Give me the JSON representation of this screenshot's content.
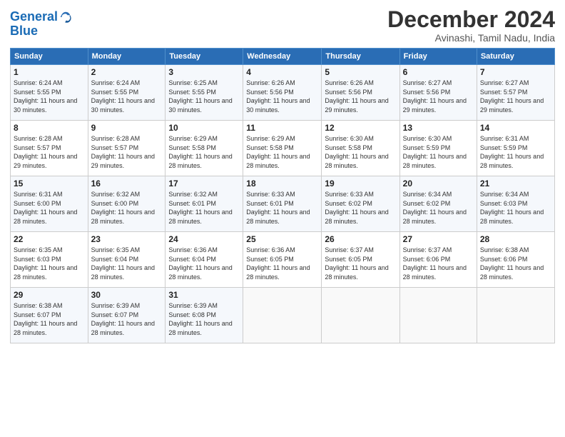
{
  "logo": {
    "line1": "General",
    "line2": "Blue"
  },
  "title": "December 2024",
  "location": "Avinashi, Tamil Nadu, India",
  "headers": [
    "Sunday",
    "Monday",
    "Tuesday",
    "Wednesday",
    "Thursday",
    "Friday",
    "Saturday"
  ],
  "weeks": [
    [
      {
        "day": "1",
        "sunrise": "6:24 AM",
        "sunset": "5:55 PM",
        "daylight": "11 hours and 30 minutes."
      },
      {
        "day": "2",
        "sunrise": "6:24 AM",
        "sunset": "5:55 PM",
        "daylight": "11 hours and 30 minutes."
      },
      {
        "day": "3",
        "sunrise": "6:25 AM",
        "sunset": "5:55 PM",
        "daylight": "11 hours and 30 minutes."
      },
      {
        "day": "4",
        "sunrise": "6:26 AM",
        "sunset": "5:56 PM",
        "daylight": "11 hours and 30 minutes."
      },
      {
        "day": "5",
        "sunrise": "6:26 AM",
        "sunset": "5:56 PM",
        "daylight": "11 hours and 29 minutes."
      },
      {
        "day": "6",
        "sunrise": "6:27 AM",
        "sunset": "5:56 PM",
        "daylight": "11 hours and 29 minutes."
      },
      {
        "day": "7",
        "sunrise": "6:27 AM",
        "sunset": "5:57 PM",
        "daylight": "11 hours and 29 minutes."
      }
    ],
    [
      {
        "day": "8",
        "sunrise": "6:28 AM",
        "sunset": "5:57 PM",
        "daylight": "11 hours and 29 minutes."
      },
      {
        "day": "9",
        "sunrise": "6:28 AM",
        "sunset": "5:57 PM",
        "daylight": "11 hours and 29 minutes."
      },
      {
        "day": "10",
        "sunrise": "6:29 AM",
        "sunset": "5:58 PM",
        "daylight": "11 hours and 28 minutes."
      },
      {
        "day": "11",
        "sunrise": "6:29 AM",
        "sunset": "5:58 PM",
        "daylight": "11 hours and 28 minutes."
      },
      {
        "day": "12",
        "sunrise": "6:30 AM",
        "sunset": "5:58 PM",
        "daylight": "11 hours and 28 minutes."
      },
      {
        "day": "13",
        "sunrise": "6:30 AM",
        "sunset": "5:59 PM",
        "daylight": "11 hours and 28 minutes."
      },
      {
        "day": "14",
        "sunrise": "6:31 AM",
        "sunset": "5:59 PM",
        "daylight": "11 hours and 28 minutes."
      }
    ],
    [
      {
        "day": "15",
        "sunrise": "6:31 AM",
        "sunset": "6:00 PM",
        "daylight": "11 hours and 28 minutes."
      },
      {
        "day": "16",
        "sunrise": "6:32 AM",
        "sunset": "6:00 PM",
        "daylight": "11 hours and 28 minutes."
      },
      {
        "day": "17",
        "sunrise": "6:32 AM",
        "sunset": "6:01 PM",
        "daylight": "11 hours and 28 minutes."
      },
      {
        "day": "18",
        "sunrise": "6:33 AM",
        "sunset": "6:01 PM",
        "daylight": "11 hours and 28 minutes."
      },
      {
        "day": "19",
        "sunrise": "6:33 AM",
        "sunset": "6:02 PM",
        "daylight": "11 hours and 28 minutes."
      },
      {
        "day": "20",
        "sunrise": "6:34 AM",
        "sunset": "6:02 PM",
        "daylight": "11 hours and 28 minutes."
      },
      {
        "day": "21",
        "sunrise": "6:34 AM",
        "sunset": "6:03 PM",
        "daylight": "11 hours and 28 minutes."
      }
    ],
    [
      {
        "day": "22",
        "sunrise": "6:35 AM",
        "sunset": "6:03 PM",
        "daylight": "11 hours and 28 minutes."
      },
      {
        "day": "23",
        "sunrise": "6:35 AM",
        "sunset": "6:04 PM",
        "daylight": "11 hours and 28 minutes."
      },
      {
        "day": "24",
        "sunrise": "6:36 AM",
        "sunset": "6:04 PM",
        "daylight": "11 hours and 28 minutes."
      },
      {
        "day": "25",
        "sunrise": "6:36 AM",
        "sunset": "6:05 PM",
        "daylight": "11 hours and 28 minutes."
      },
      {
        "day": "26",
        "sunrise": "6:37 AM",
        "sunset": "6:05 PM",
        "daylight": "11 hours and 28 minutes."
      },
      {
        "day": "27",
        "sunrise": "6:37 AM",
        "sunset": "6:06 PM",
        "daylight": "11 hours and 28 minutes."
      },
      {
        "day": "28",
        "sunrise": "6:38 AM",
        "sunset": "6:06 PM",
        "daylight": "11 hours and 28 minutes."
      }
    ],
    [
      {
        "day": "29",
        "sunrise": "6:38 AM",
        "sunset": "6:07 PM",
        "daylight": "11 hours and 28 minutes."
      },
      {
        "day": "30",
        "sunrise": "6:39 AM",
        "sunset": "6:07 PM",
        "daylight": "11 hours and 28 minutes."
      },
      {
        "day": "31",
        "sunrise": "6:39 AM",
        "sunset": "6:08 PM",
        "daylight": "11 hours and 28 minutes."
      },
      null,
      null,
      null,
      null
    ]
  ]
}
